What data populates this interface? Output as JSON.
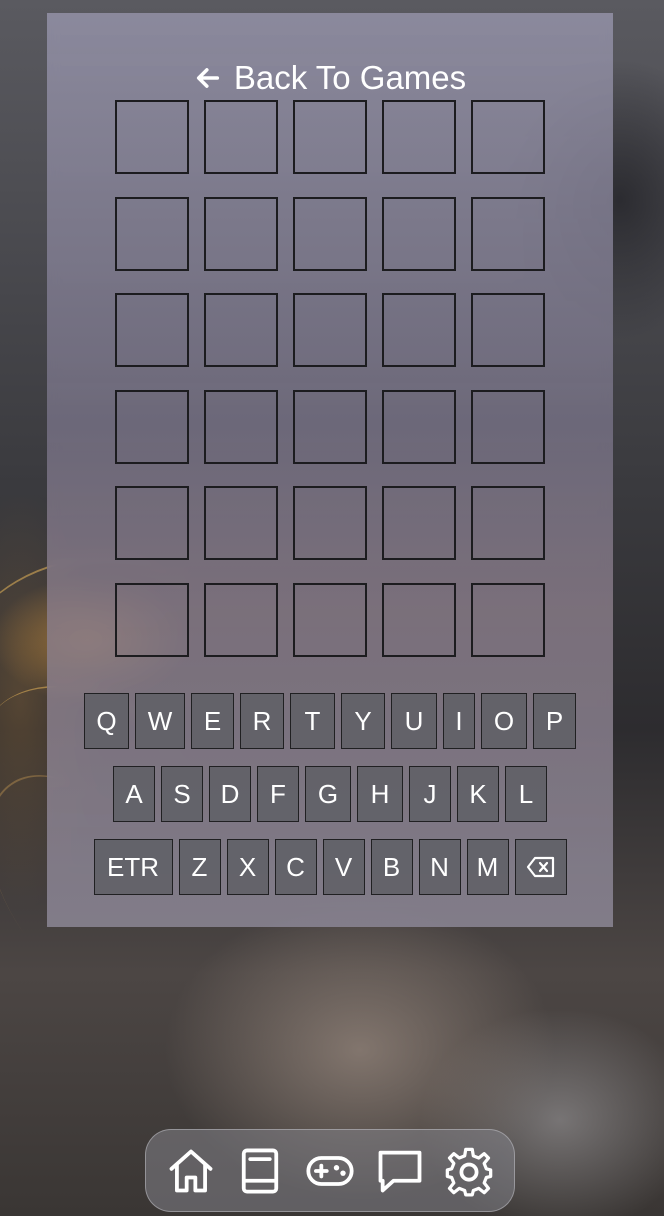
{
  "header": {
    "back_label": "Back To Games",
    "back_icon": "arrow-left-icon"
  },
  "board": {
    "rows": 6,
    "columns": 5,
    "cells": [
      [
        "",
        "",
        "",
        "",
        ""
      ],
      [
        "",
        "",
        "",
        "",
        ""
      ],
      [
        "",
        "",
        "",
        "",
        ""
      ],
      [
        "",
        "",
        "",
        "",
        ""
      ],
      [
        "",
        "",
        "",
        "",
        ""
      ],
      [
        "",
        "",
        "",
        "",
        ""
      ]
    ]
  },
  "keyboard": {
    "row1": [
      "Q",
      "W",
      "E",
      "R",
      "T",
      "Y",
      "U",
      "I",
      "O",
      "P"
    ],
    "row2": [
      "A",
      "S",
      "D",
      "F",
      "G",
      "H",
      "J",
      "K",
      "L"
    ],
    "row3": [
      "ETR",
      "Z",
      "X",
      "C",
      "V",
      "B",
      "N",
      "M"
    ],
    "backspace_icon": "backspace-icon"
  },
  "dock": {
    "items": [
      "home-icon",
      "book-icon",
      "gamepad-icon",
      "chat-icon",
      "gear-icon"
    ]
  },
  "colors": {
    "panel": "#8c8aa0",
    "key": "#626268",
    "border": "#1c1c1f",
    "text": "#ffffff"
  }
}
